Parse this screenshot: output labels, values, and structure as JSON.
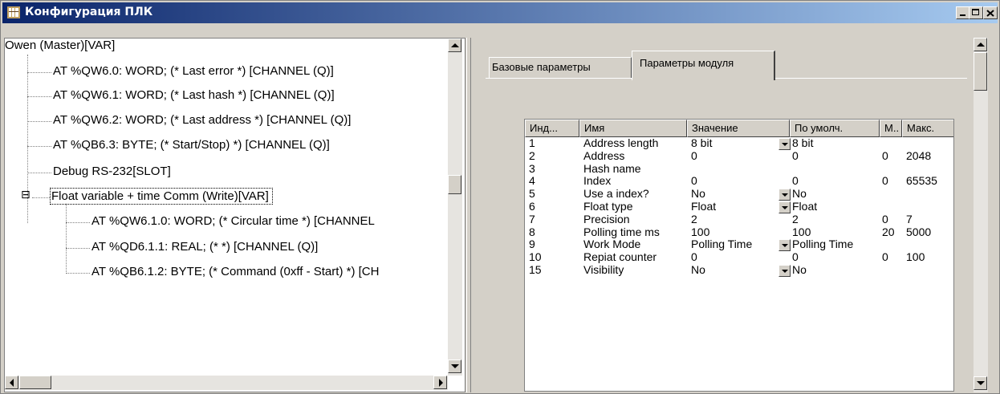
{
  "window": {
    "title": "Конфигурация ПЛК"
  },
  "tree": {
    "items": [
      "Owen (Master)[VAR]",
      "AT %QW6.0: WORD; (* Last error *) [CHANNEL (Q)]",
      "AT %QW6.1: WORD; (* Last hash *) [CHANNEL (Q)]",
      "AT %QW6.2: WORD; (* Last address *) [CHANNEL (Q)]",
      "AT %QB6.3: BYTE; (* Start/Stop) *) [CHANNEL (Q)]",
      "Debug RS-232[SLOT]",
      "Float variable + time Comm (Write)[VAR]",
      "AT %QW6.1.0: WORD; (* Circular time *) [CHANNEL",
      "AT %QD6.1.1: REAL; (*  *) [CHANNEL (Q)]",
      "AT %QB6.1.2: BYTE; (* Command (0xff - Start) *) [CH"
    ],
    "expander": "⊟"
  },
  "tabs": [
    "Базовые параметры",
    "Параметры модуля"
  ],
  "table": {
    "headers": [
      "Инд...",
      "Имя",
      "Значение",
      "По умолч.",
      "М..",
      "Макс."
    ],
    "rows": [
      [
        "1",
        "Address length",
        "8 bit",
        "8 bit",
        "",
        ""
      ],
      [
        "2",
        "Address",
        "0",
        "0",
        "0",
        "2048"
      ],
      [
        "3",
        "Hash name",
        "",
        "",
        "",
        ""
      ],
      [
        "4",
        "Index",
        "0",
        "0",
        "0",
        "65535"
      ],
      [
        "5",
        "Use a index?",
        "No",
        "No",
        "",
        ""
      ],
      [
        "6",
        "Float type",
        "Float",
        "Float",
        "",
        ""
      ],
      [
        "7",
        "Precision",
        "2",
        "2",
        "0",
        "7"
      ],
      [
        "8",
        "Polling time ms",
        "100",
        "100",
        "20",
        "5000"
      ],
      [
        "9",
        "Work Mode",
        "Polling Time",
        "Polling Time",
        "",
        ""
      ],
      [
        "10",
        "Repiat counter",
        "0",
        "0",
        "0",
        "100"
      ],
      [
        "15",
        "Visibility",
        "No",
        "No",
        "",
        ""
      ]
    ],
    "dropdown_rows": [
      0,
      4,
      5,
      8,
      10
    ]
  },
  "icons": {
    "app": "plc-config-icon",
    "minimize": "minimize-icon",
    "maximize": "maximize-icon",
    "close": "close-icon"
  },
  "colors": {
    "titlebar_start": "#0a246a",
    "titlebar_end": "#a6caf0",
    "face": "#d4d0c8"
  }
}
